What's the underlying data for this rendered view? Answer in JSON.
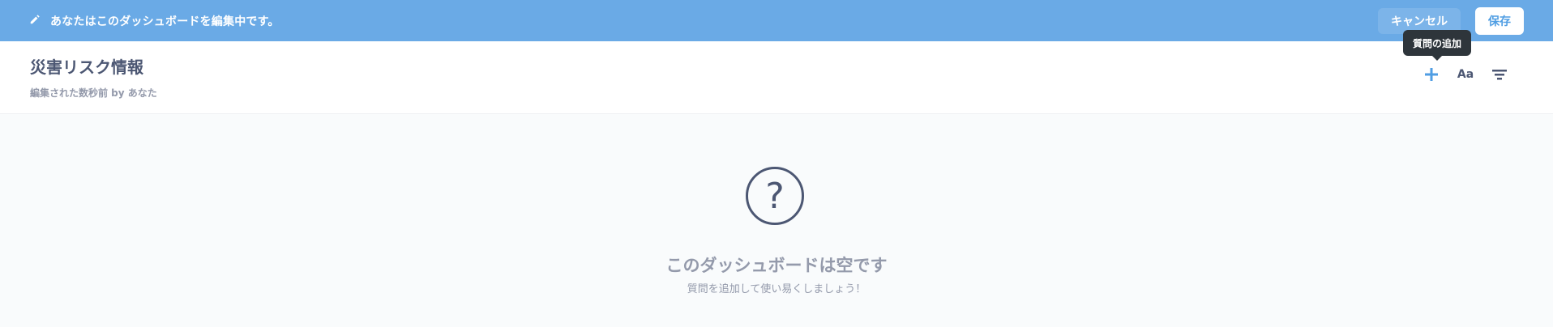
{
  "edit_bar": {
    "message": "あなたはこのダッシュボードを編集中です。",
    "cancel_label": "キャンセル",
    "save_label": "保存",
    "colors": {
      "background": "#6aaae6",
      "save_text": "#509ee3"
    }
  },
  "dashboard": {
    "title": "災害リスク情報",
    "subtitle": "編集された数秒前 by あなた"
  },
  "tools": {
    "tooltip": "質問の追加",
    "text_card_label": "Aa",
    "icons": [
      "plus-icon",
      "text-icon",
      "filter-icon"
    ]
  },
  "empty_state": {
    "icon": "?",
    "heading": "このダッシュボードは空です",
    "hint": "質問を追加して使い易くしましょう！"
  }
}
